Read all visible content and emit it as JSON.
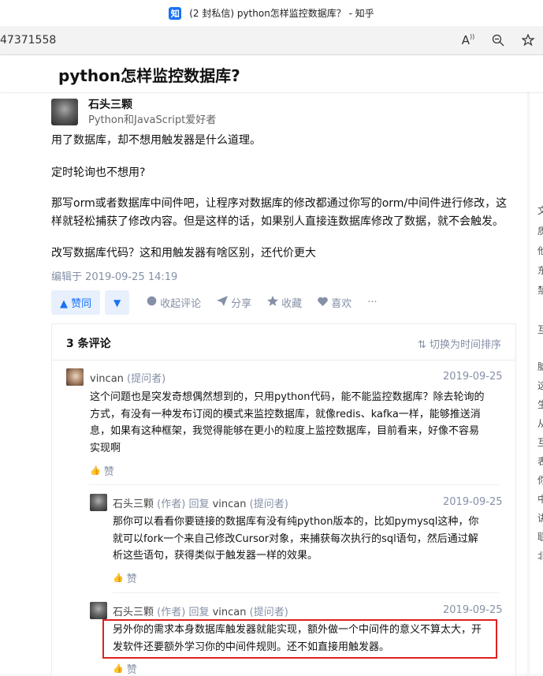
{
  "browser": {
    "tab_title": "(2 封私信) python怎样监控数据库？ - 知乎",
    "favicon_char": "知",
    "url_visible": "47371558",
    "icons": [
      "read-aloud-icon",
      "zoom-icon",
      "favorites-add-icon"
    ]
  },
  "question": {
    "title": "python怎样监控数据库?"
  },
  "answer": {
    "author_name": "石头三颗",
    "author_bio": "Python和JavaScript爱好者",
    "paragraphs": [
      "用了数据库，却不想用触发器是什么道理。",
      "定时轮询也不想用?",
      "那写orm或者数据库中间件吧，让程序对数据库的修改都通过你写的orm/中间件进行修改，这样就轻松捕获了修改内容。但是这样的话，如果别人直接连数据库修改了数据，就不会触发。",
      "改写数据库代码？这和用触发器有啥区别，还代价更大"
    ],
    "edit_time": "编辑于 2019-09-25 14:19",
    "actions": {
      "upvote": "▲ 赞同",
      "downvote": "▼",
      "comment": "收起评论",
      "share": "分享",
      "collect": "收藏",
      "like": "喜欢",
      "more": "···"
    }
  },
  "comments": {
    "count_label": "3 条评论",
    "sort_label": "切换为时间排序",
    "items": [
      {
        "author": "vincan",
        "role": "(提问者)",
        "date": "2019-09-25",
        "lines": [
          "这个问题也是突发奇想偶然想到的，只用python代码，能不能监控数据库？除去轮询的",
          "方式，有没有一种发布订阅的模式来监控数据库，就像redis、kafka一样，能够推送消",
          "息，如果有这种框架，我觉得能够在更小的粒度上监控数据库，目前看来，好像不容易",
          "实现啊"
        ],
        "like": "赞"
      },
      {
        "author": "石头三颗",
        "role": "(作者)",
        "reply_word": "回复",
        "reply_to": "vincan",
        "reply_role": "(提问者)",
        "date": "2019-09-25",
        "lines": [
          "那你可以看看你要链接的数据库有没有纯python版本的，比如pymysql这种，你",
          "就可以fork一个来自己修改Cursor对象，来捕获每次执行的sql语句，然后通过解",
          "析这些语句，获得类似于触发器一样的效果。"
        ],
        "like": "赞"
      },
      {
        "author": "石头三颗",
        "role": "(作者)",
        "reply_word": "回复",
        "reply_to": "vincan",
        "reply_role": "(提问者)",
        "date": "2019-09-25",
        "lines": [
          "另外你的需求本身数据库触发器就能实现，额外做一个中间件的意义不算太大，开",
          "发软件还要额外学习你的中间件规则。还不如直接用触发器。"
        ],
        "like": "赞"
      }
    ]
  },
  "sidebar_fragments": [
    "文",
    "质",
    "他",
    "东",
    "禁",
    "互",
    "脑",
    "这",
    "生",
    "从",
    "互",
    "表",
    "你",
    "中",
    "讲",
    "联",
    "北"
  ],
  "colors": {
    "brand_blue": "#1772f6",
    "muted_gray": "#8590a6",
    "highlight_red": "#e02020"
  }
}
